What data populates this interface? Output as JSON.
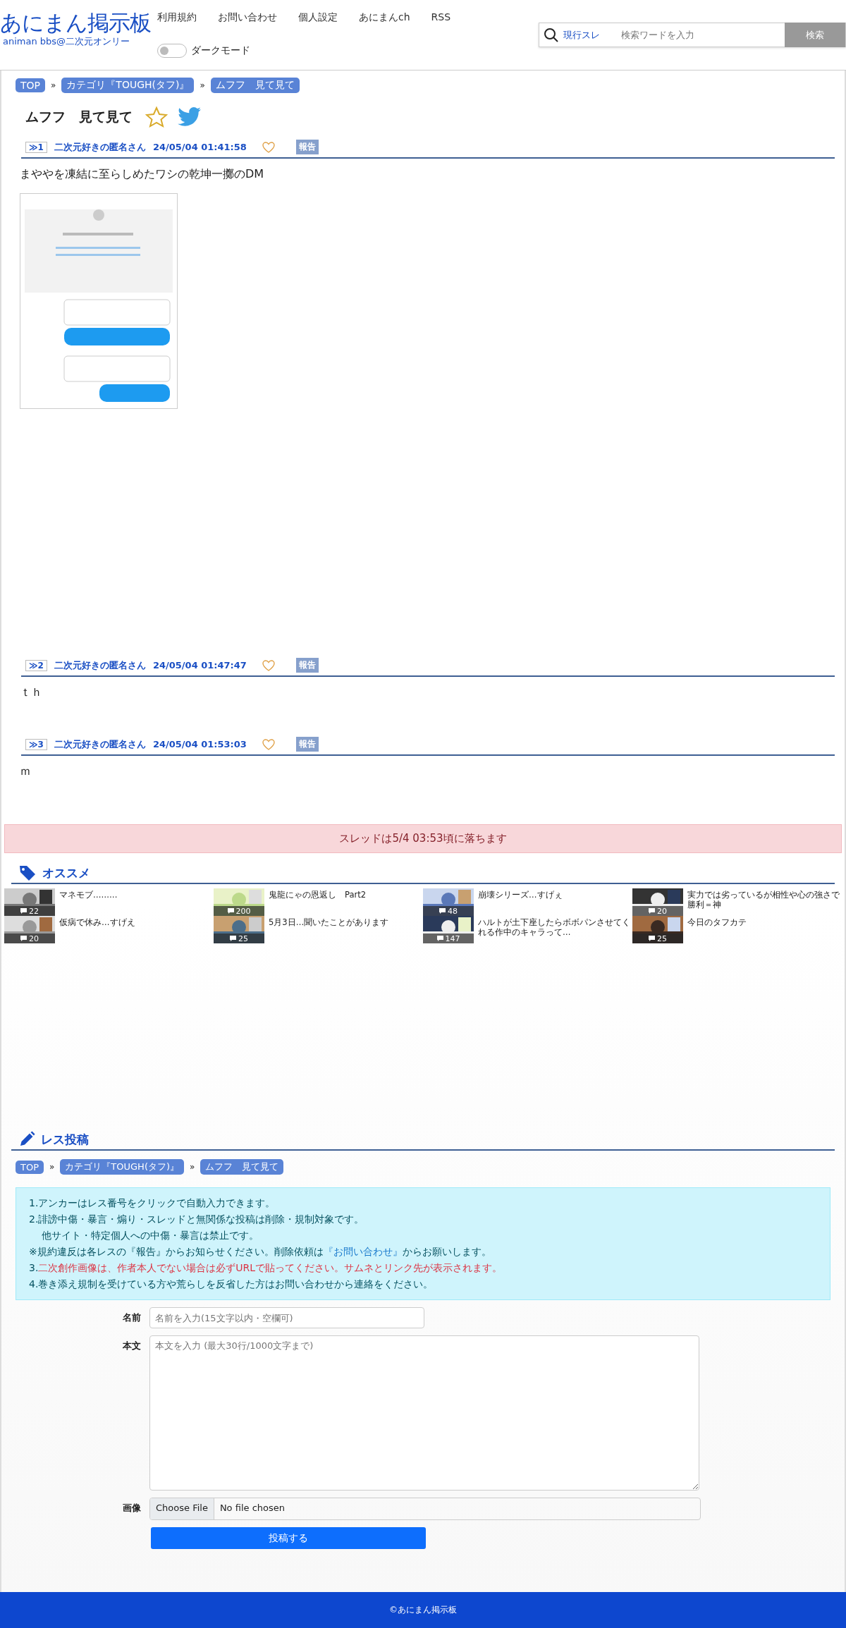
{
  "header": {
    "logo": "あにまん掲示板",
    "logo_sub": "animan bbs@二次元オンリー",
    "nav": [
      "利用規約",
      "お問い合わせ",
      "個人設定",
      "あにまんch",
      "RSS"
    ],
    "dark_mode": {
      "label": "ダークモード",
      "on": false
    },
    "search": {
      "scope": "現行スレ",
      "placeholder": "検索ワードを入力",
      "button": "検索"
    }
  },
  "breadcrumb": {
    "items": [
      "TOP",
      "カテゴリ『TOUGH(タフ)』",
      "ムフフ　見て見て"
    ],
    "separators": [
      "»",
      "»"
    ]
  },
  "thread_title": "ムフフ　見て見て",
  "favorite": false,
  "posts": [
    {
      "anchor": "≫1",
      "author": "二次元好きの匿名さん",
      "date": "24/05/04 01:41:58",
      "liked": false,
      "report": "報告",
      "body": "まややを凍結に至らしめたワシの乾坤一擲のDM"
    },
    {
      "anchor": "≫2",
      "author": "二次元好きの匿名さん",
      "date": "24/05/04 01:47:47",
      "liked": false,
      "report": "報告",
      "body": "ｔｈ"
    },
    {
      "anchor": "≫3",
      "author": "二次元好きの匿名さん",
      "date": "24/05/04 01:53:03",
      "liked": false,
      "report": "報告",
      "body": "ｍ"
    }
  ],
  "notice": "スレッドは5/4 03:53頃に落ちます",
  "recommend": {
    "title": "オススメ",
    "items": [
      {
        "title": "マネモブ………",
        "count": "22"
      },
      {
        "title": "鬼龍にゃの恩返し　Part2",
        "count": "200"
      },
      {
        "title": "崩壊シリーズ…すげぇ",
        "count": "48"
      },
      {
        "title": "実力では劣っているが相性や心の強さで勝利＝神",
        "count": "20"
      },
      {
        "title": "仮病で休み…すげえ",
        "count": "20"
      },
      {
        "title": "5月3日…聞いたことがあります",
        "count": "25"
      },
      {
        "title": "ハルトが土下座したらボボパンさせてくれる作中のキャラって…",
        "count": "147"
      },
      {
        "title": "今日のタフカテ",
        "count": "25"
      }
    ]
  },
  "post_form": {
    "title": "レス投稿",
    "breadcrumb": {
      "items": [
        "TOP",
        "カテゴリ『TOUGH(タフ)』",
        "ムフフ　見て見て"
      ],
      "separators": [
        "»",
        "»"
      ]
    },
    "rules": [
      {
        "kind": "plain",
        "text": "1.アンカーはレス番号をクリックで自動入力できます。"
      },
      {
        "kind": "plain",
        "text": "2.誹謗中傷・暴言・煽り・スレッドと無関係な投稿は削除・規制対象です。"
      },
      {
        "kind": "indent",
        "text": "他サイト・特定個人への中傷・暴言は禁止です。"
      },
      {
        "kind": "link",
        "text": "※規約違反は各レスの『報告』からお知らせください。削除依頼は",
        "link": "『お問い合わせ』",
        "after": "からお願いします。"
      },
      {
        "kind": "warn",
        "prefix": "3.",
        "text": "二次創作画像は、作者本人でない場合は必ずURLで貼ってください。サムネとリンク先が表示されます。"
      },
      {
        "kind": "plain",
        "text": "4.巻き添え規制を受けている方や荒らしを反省した方はお問い合わせから連絡をください。"
      }
    ],
    "name_label": "名前",
    "name_placeholder": "名前を入力(15文字以内・空欄可)",
    "body_label": "本文",
    "body_placeholder": "本文を入力 (最大30行/1000文字まで)",
    "image_label": "画像",
    "file_button": "Choose File",
    "file_status": "No file chosen",
    "submit": "投稿する"
  },
  "footer": "©あにまん掲示板"
}
